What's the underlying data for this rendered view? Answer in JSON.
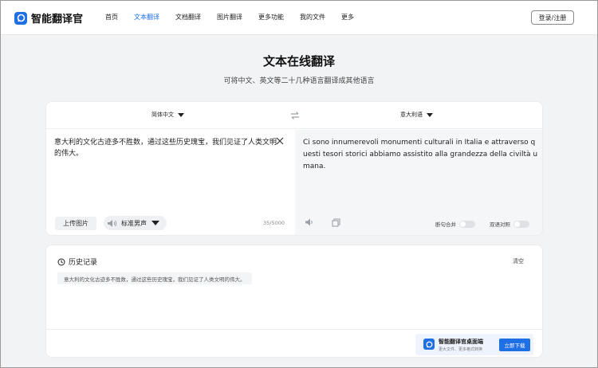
{
  "brand": {
    "name": "智能翻译官",
    "accent": "#1f6fe5"
  },
  "nav": {
    "items": [
      {
        "label": "首页",
        "active": false
      },
      {
        "label": "文本翻译",
        "active": true
      },
      {
        "label": "文档翻译",
        "active": false
      },
      {
        "label": "图片翻译",
        "active": false
      },
      {
        "label": "更多功能",
        "active": false
      },
      {
        "label": "我的文件",
        "active": false
      },
      {
        "label": "更多",
        "active": false
      }
    ],
    "login_label": "登录/注册"
  },
  "hero": {
    "title": "文本在线翻译",
    "subtitle": "可将中文、英文等二十几种语言翻译成其他语言"
  },
  "translator": {
    "source_lang": "简体中文",
    "target_lang": "意大利语",
    "source_text": "意大利的文化古迹多不胜数，通过这些历史瑰宝，我们见证了人类文明的伟大。",
    "target_text": "Ci sono innumerevoli monumenti culturali in Italia e attraverso questi tesori storici abbiamo assistito alla grandezza della civiltà umana.",
    "upload_label": "上传图片",
    "voice_label": "标准男声",
    "char_count": "35/5000",
    "sentence_merge_label": "断句合并",
    "sentence_merge_on": false,
    "bilingual_label": "双语对照",
    "bilingual_on": false
  },
  "history": {
    "title": "历史记录",
    "clear_label": "清空",
    "items": [
      "意大利的文化古迹多不胜数，通过这些历史瑰宝，我们见证了人类文明的伟大。"
    ]
  },
  "promo": {
    "title": "智能翻译官桌面端",
    "subtitle": "更大文件、更多格式转换",
    "button_label": "立即下载"
  },
  "icons": {
    "logo": "translator-logo-icon",
    "swap": "swap-arrows-icon",
    "clear": "close-icon",
    "speaker": "speaker-icon",
    "copy": "copy-icon",
    "history": "clock-history-icon",
    "dropdown": "caret-down-icon"
  }
}
